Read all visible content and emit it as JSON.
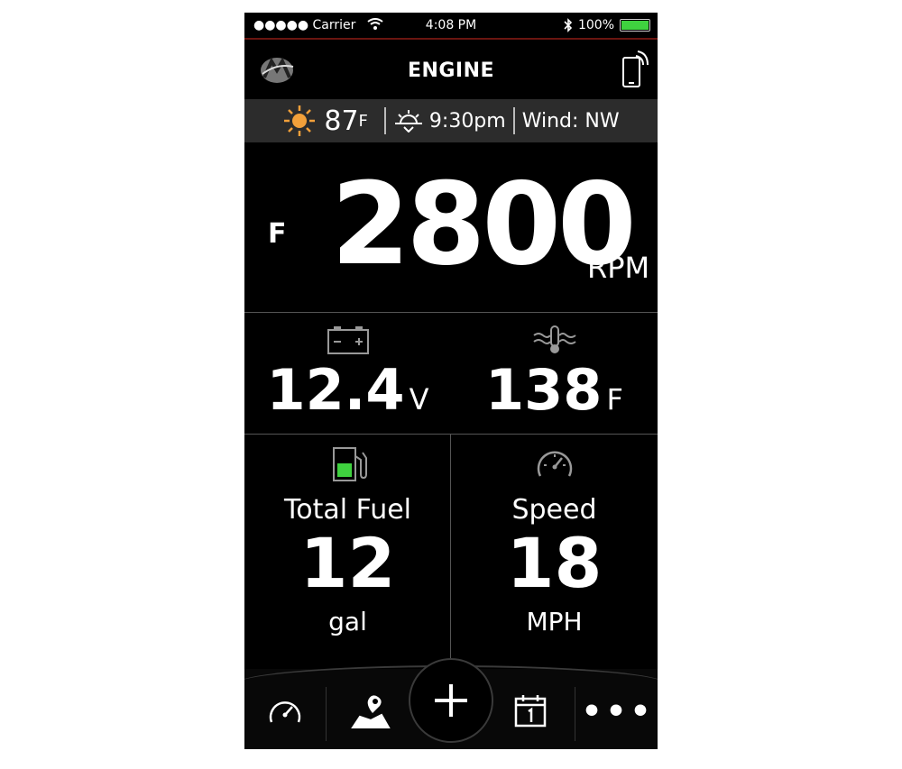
{
  "status_bar": {
    "carrier": "●●●●● Carrier",
    "time": "4:08 PM",
    "battery": "100%",
    "battery_level": 1.0
  },
  "header": {
    "title": "ENGINE",
    "logo_icon": "mercury-logo-icon",
    "device_icon": "phone-connect-icon"
  },
  "weather": {
    "temperature": "87",
    "temp_unit": "F",
    "sunset_time": "9:30pm",
    "wind": "Wind: NW"
  },
  "rpm": {
    "side_label": "F",
    "value": "2800",
    "unit": "RPM"
  },
  "battery_gauge": {
    "value": "12.4",
    "unit": "V"
  },
  "water_temp": {
    "value": "138",
    "unit": "F"
  },
  "fuel": {
    "label": "Total Fuel",
    "value": "12",
    "unit": "gal"
  },
  "speed": {
    "label": "Speed",
    "value": "18",
    "unit": "MPH"
  },
  "colors": {
    "accent_orange": "#f2a03a",
    "fuel_green": "#3fd23f",
    "red_line": "#6a1510"
  },
  "tabs": {
    "more": "•••"
  }
}
